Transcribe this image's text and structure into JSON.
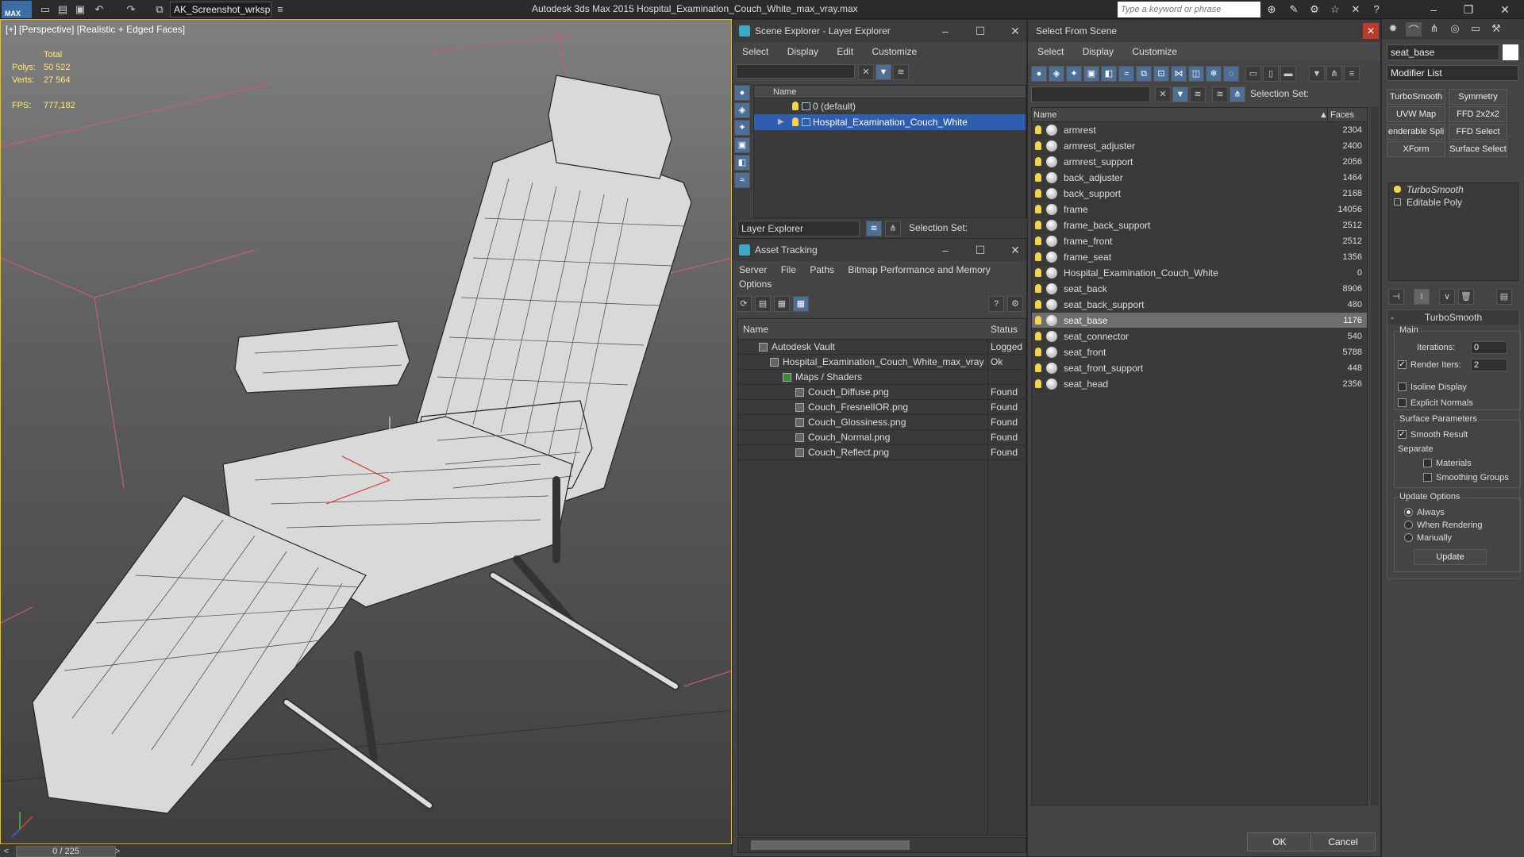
{
  "titlebar": {
    "logo": "MAX",
    "workspace": "AK_Screenshot_wrksp",
    "title": "Autodesk 3ds Max  2015     Hospital_Examination_Couch_White_max_vray.max",
    "search_placeholder": "Type a keyword or phrase"
  },
  "viewport": {
    "label": "[+] [Perspective] [Realistic + Edged Faces]",
    "stats_total": "Total",
    "polys_label": "Polys:",
    "polys_value": "50 522",
    "verts_label": "Verts:",
    "verts_value": "27 564",
    "fps_label": "FPS:",
    "fps_value": "777,182"
  },
  "timeslider": {
    "frame": "0 / 225"
  },
  "scene_explorer": {
    "title": "Scene Explorer - Layer Explorer",
    "menu": [
      "Select",
      "Display",
      "Edit",
      "Customize"
    ],
    "column_name": "Name",
    "layers": [
      {
        "name": "0 (default)",
        "selected": false
      },
      {
        "name": "Hospital_Examination_Couch_White",
        "selected": true
      }
    ],
    "explorer_type": "Layer Explorer",
    "selection_set_label": "Selection Set:"
  },
  "asset_tracking": {
    "title": "Asset Tracking",
    "menu_row1": [
      "Server",
      "File",
      "Paths",
      "Bitmap Performance and Memory"
    ],
    "menu_row2": [
      "Options"
    ],
    "col_name": "Name",
    "col_status": "Status",
    "rows": [
      {
        "name": "Autodesk Vault",
        "status": "Logged",
        "indent": 1
      },
      {
        "name": "Hospital_Examination_Couch_White_max_vray...",
        "status": "Ok",
        "indent": 2
      },
      {
        "name": "Maps / Shaders",
        "status": "",
        "indent": 3
      },
      {
        "name": "Couch_Diffuse.png",
        "status": "Found",
        "indent": 4
      },
      {
        "name": "Couch_FresnelIOR.png",
        "status": "Found",
        "indent": 4
      },
      {
        "name": "Couch_Glossiness.png",
        "status": "Found",
        "indent": 4
      },
      {
        "name": "Couch_Normal.png",
        "status": "Found",
        "indent": 4
      },
      {
        "name": "Couch_Reflect.png",
        "status": "Found",
        "indent": 4
      }
    ]
  },
  "select_from_scene": {
    "title": "Select From Scene",
    "menu": [
      "Select",
      "Display",
      "Customize"
    ],
    "selection_set_label": "Selection Set:",
    "col_name": "Name",
    "col_faces": "Faces",
    "objects": [
      {
        "name": "armrest",
        "faces": "2304"
      },
      {
        "name": "armrest_adjuster",
        "faces": "2400"
      },
      {
        "name": "armrest_support",
        "faces": "2056"
      },
      {
        "name": "back_adjuster",
        "faces": "1464"
      },
      {
        "name": "back_support",
        "faces": "2168"
      },
      {
        "name": "frame",
        "faces": "14056"
      },
      {
        "name": "frame_back_support",
        "faces": "2512"
      },
      {
        "name": "frame_front",
        "faces": "2512"
      },
      {
        "name": "frame_seat",
        "faces": "1356"
      },
      {
        "name": "Hospital_Examination_Couch_White",
        "faces": "0"
      },
      {
        "name": "seat_back",
        "faces": "8906"
      },
      {
        "name": "seat_back_support",
        "faces": "480"
      },
      {
        "name": "seat_base",
        "faces": "1176",
        "highlight": true
      },
      {
        "name": "seat_connector",
        "faces": "540"
      },
      {
        "name": "seat_front",
        "faces": "5788"
      },
      {
        "name": "seat_front_support",
        "faces": "448"
      },
      {
        "name": "seat_head",
        "faces": "2356"
      }
    ],
    "ok_label": "OK",
    "cancel_label": "Cancel"
  },
  "command_panel": {
    "object_name": "seat_base",
    "modifier_list": "Modifier List",
    "modifier_buttons": [
      "TurboSmooth",
      "Symmetry",
      "UVW Map",
      "FFD 2x2x2",
      "enderable Spli",
      "FFD Select",
      "XForm",
      "Surface Select"
    ],
    "stack": [
      "TurboSmooth",
      "Editable Poly"
    ],
    "turbosmooth": {
      "title": "TurboSmooth",
      "main_label": "Main",
      "iterations_label": "Iterations:",
      "iterations_value": "0",
      "render_iters_label": "Render Iters:",
      "render_iters_value": "2",
      "render_iters_checked": true,
      "isoline_label": "Isoline Display",
      "explicit_normals_label": "Explicit Normals",
      "surface_params_label": "Surface Parameters",
      "smooth_result_label": "Smooth Result",
      "smooth_result_checked": true,
      "separate_label": "Separate",
      "materials_label": "Materials",
      "smoothing_groups_label": "Smoothing Groups",
      "update_options_label": "Update Options",
      "always_label": "Always",
      "when_rendering_label": "When Rendering",
      "manually_label": "Manually",
      "update_button": "Update"
    }
  },
  "colors": {
    "accent_blue": "#2f5eae",
    "viewport_border": "#f0c000",
    "stats_yellow": "#ffeb70"
  }
}
